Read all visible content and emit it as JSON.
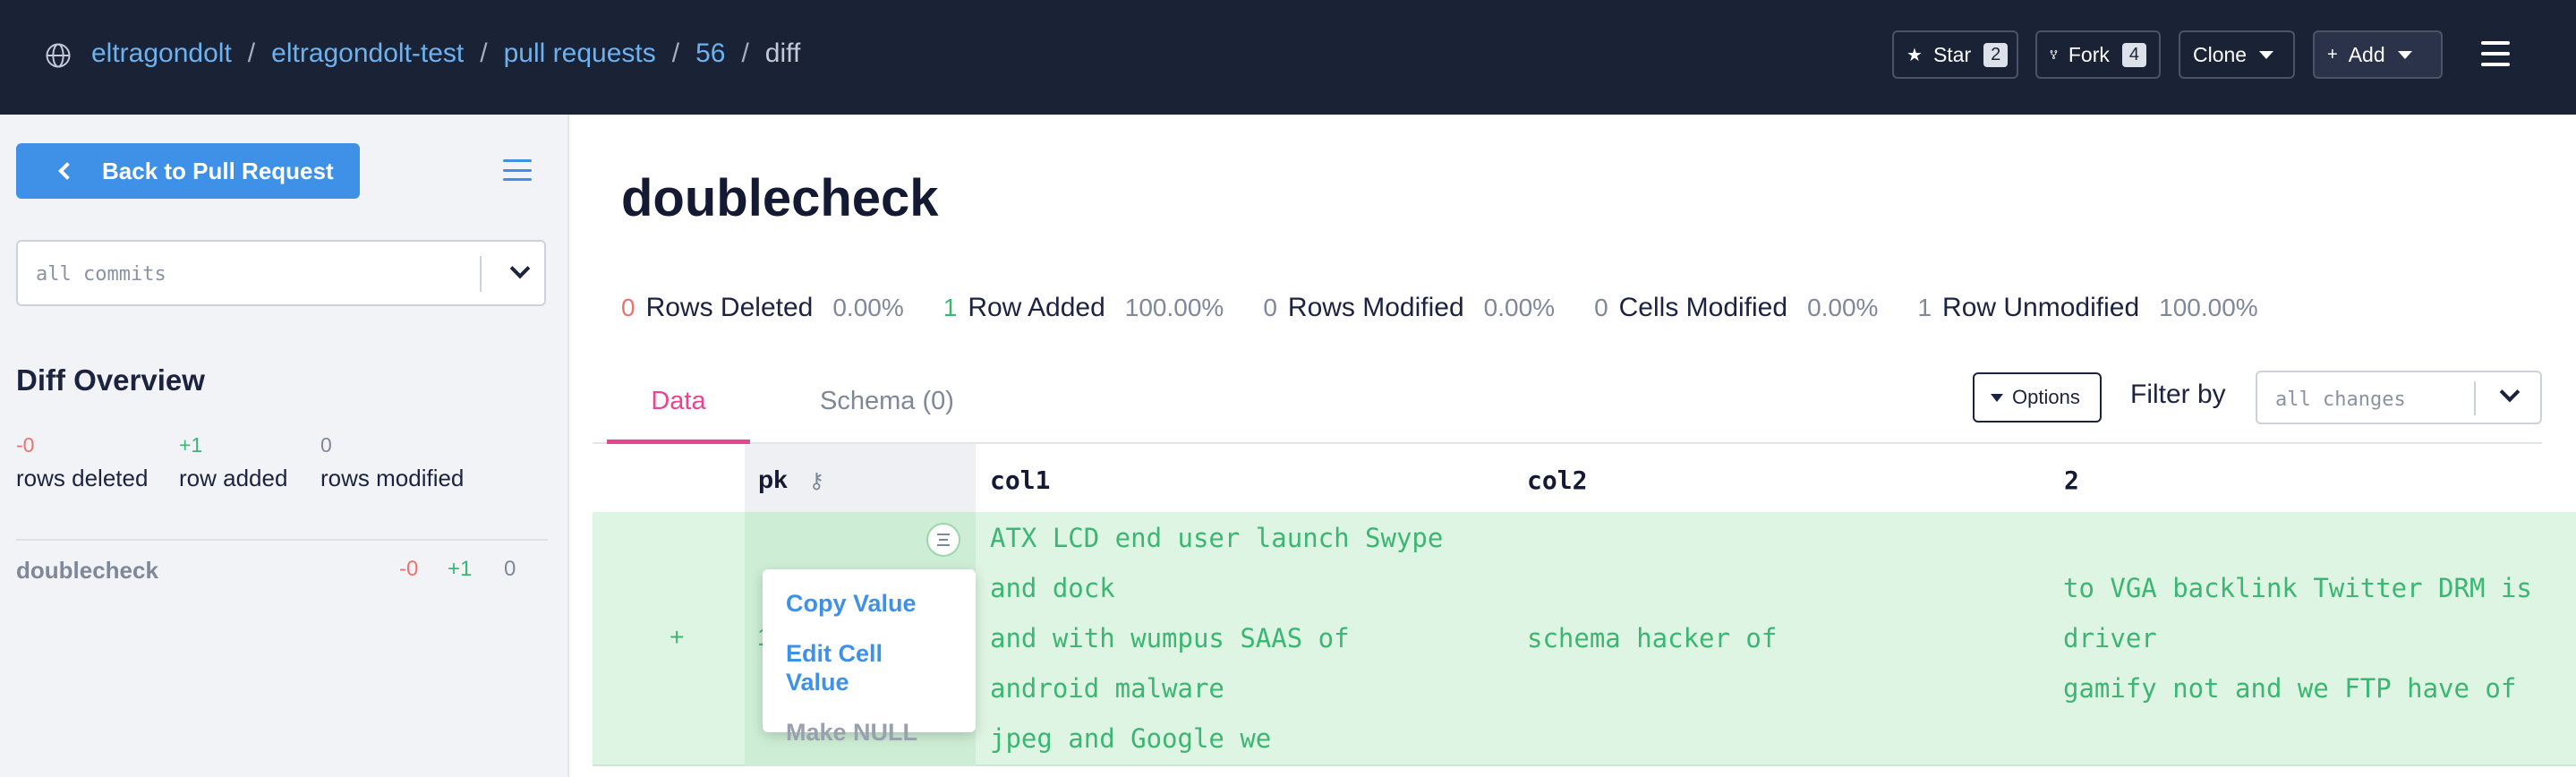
{
  "navbar": {
    "breadcrumbs": [
      "eltragondolt",
      "eltragondolt-test",
      "pull requests",
      "56"
    ],
    "current": "diff",
    "separator": "/",
    "star_label": "Star",
    "star_count": "2",
    "fork_label": "Fork",
    "fork_count": "4",
    "clone_label": "Clone",
    "add_label": "Add",
    "add_prefix": "+"
  },
  "sidebar": {
    "back_button": "Back to Pull Request",
    "commit_placeholder": "all commits",
    "overview_title": "Diff Overview",
    "stats": {
      "deleted_num": "-0",
      "deleted_label": "rows deleted",
      "added_num": "+1",
      "added_label": "row added",
      "modified_num": "0",
      "modified_label": "rows modified"
    },
    "tables": [
      {
        "name": "doublecheck",
        "deleted": "-0",
        "added": "+1",
        "modified": "0"
      }
    ]
  },
  "main": {
    "title": "doublecheck",
    "summary": {
      "deleted_count": "0",
      "deleted_label": "Rows Deleted",
      "deleted_pct": "0.00%",
      "added_count": "1",
      "added_label": "Row Added",
      "added_pct": "100.00%",
      "modified_count": "0",
      "modified_label": "Rows Modified",
      "modified_pct": "0.00%",
      "cells_count": "0",
      "cells_label": "Cells Modified",
      "cells_pct": "0.00%",
      "unmodified_count": "1",
      "unmodified_label": "Row Unmodified",
      "unmodified_pct": "100.00%"
    },
    "tabs": {
      "data": "Data",
      "schema": "Schema (0)"
    },
    "options_label": "Options",
    "filter_label": "Filter by",
    "filter_placeholder": "all changes"
  },
  "table": {
    "columns": [
      "pk",
      "col1",
      "col2",
      "2"
    ],
    "row": {
      "marker": "+",
      "pk": "1",
      "col1": [
        "ATX LCD end user launch Swype",
        "and dock",
        "and with wumpus SAAS of",
        "android malware",
        "jpeg and Google we"
      ],
      "col2": "schema hacker of",
      "c2": [
        "to VGA backlink Twitter DRM is",
        "driver",
        "gamify not and we FTP have of"
      ]
    }
  },
  "context_menu": {
    "copy": "Copy Value",
    "edit": "Edit Cell Value",
    "null": "Make NULL"
  },
  "colors": {
    "navbar_bg": "#1a2236",
    "link": "#6cb2f0",
    "accent_pink": "#e6458f",
    "added_green": "#3bb673",
    "deleted_red": "#f2706c",
    "row_added_bg": "#dff5e3",
    "primary_blue": "#3f91e8"
  },
  "icons": [
    "globe-icon",
    "star-icon",
    "fork-icon",
    "plus-icon",
    "menu-icon",
    "chevron-left-icon",
    "list-icon",
    "chevron-down-icon",
    "key-icon",
    "cell-menu-icon"
  ]
}
